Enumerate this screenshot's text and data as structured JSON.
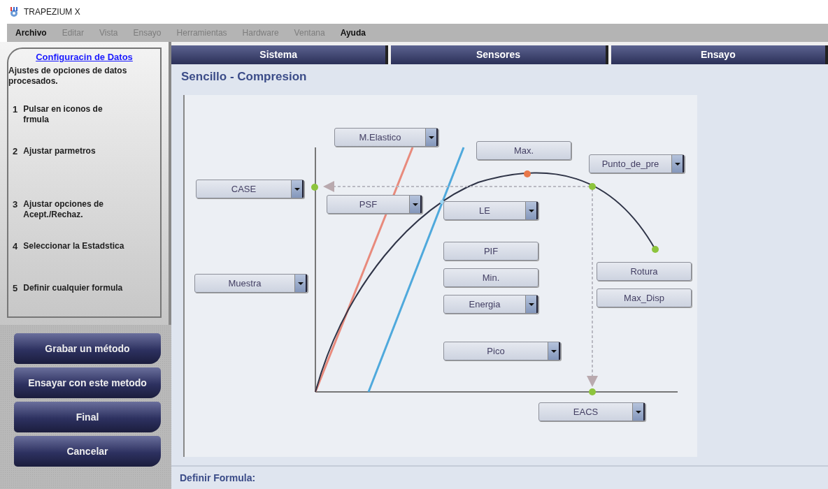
{
  "window": {
    "title": "TRAPEZIUM X"
  },
  "menu": [
    {
      "label": "Archivo",
      "disabled": false
    },
    {
      "label": "Editar",
      "disabled": true
    },
    {
      "label": "Vista",
      "disabled": true
    },
    {
      "label": "Ensayo",
      "disabled": true
    },
    {
      "label": "Herramientas",
      "disabled": true
    },
    {
      "label": "Hardware",
      "disabled": true
    },
    {
      "label": "Ventana",
      "disabled": true
    },
    {
      "label": "Ayuda",
      "disabled": false
    }
  ],
  "sidebar": {
    "title": "Configuracin de Datos",
    "description": "Ajustes de opciones de datos procesados.",
    "steps": [
      {
        "number": "1",
        "text": "Pulsar en iconos de frmula"
      },
      {
        "number": "2",
        "text": "Ajustar parmetros"
      },
      {
        "number": "3",
        "text": "Ajustar opciones de Acept./Rechaz."
      },
      {
        "number": "4",
        "text": "Seleccionar la Estadstica"
      },
      {
        "number": "5",
        "text": "Definir cualquier formula"
      }
    ],
    "buttons": [
      "Grabar un método",
      "Ensayar con este metodo",
      "Final",
      "Cancelar"
    ]
  },
  "tabs": [
    "Sistema",
    "Sensores",
    "Ensayo"
  ],
  "heading": "Sencillo - Compresion",
  "diagram": {
    "widgets": [
      {
        "kind": "combo",
        "label": "M.Elastico"
      },
      {
        "kind": "button",
        "label": "Max."
      },
      {
        "kind": "combo",
        "label": "Punto_de_pre"
      },
      {
        "kind": "combo",
        "label": "CASE"
      },
      {
        "kind": "combo",
        "label": "PSF"
      },
      {
        "kind": "combo",
        "label": "LE"
      },
      {
        "kind": "button",
        "label": "PIF"
      },
      {
        "kind": "button",
        "label": "Min."
      },
      {
        "kind": "combo",
        "label": "Energia"
      },
      {
        "kind": "button",
        "label": "Rotura"
      },
      {
        "kind": "button",
        "label": "Max_Disp"
      },
      {
        "kind": "combo",
        "label": "Muestra"
      },
      {
        "kind": "combo",
        "label": "Pico"
      },
      {
        "kind": "combo",
        "label": "EACS"
      }
    ]
  },
  "footer": "Definir Formula:"
}
